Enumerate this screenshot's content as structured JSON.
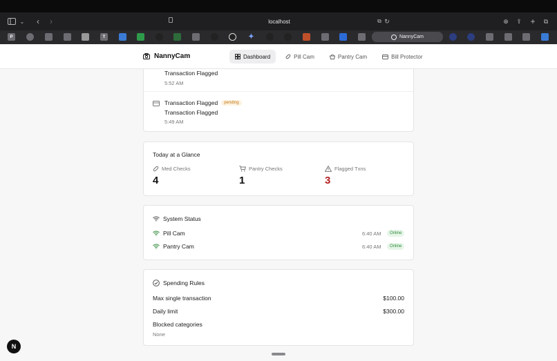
{
  "browser": {
    "url": "localhost",
    "active_tab_label": "NannyCam"
  },
  "app": {
    "brand": "NannyCam",
    "nav": [
      {
        "label": "Dashboard",
        "icon": "grid-icon"
      },
      {
        "label": "Pill Cam",
        "icon": "pill-icon"
      },
      {
        "label": "Pantry Cam",
        "icon": "basket-icon"
      },
      {
        "label": "Bill Protector",
        "icon": "card-icon"
      }
    ]
  },
  "transactions": [
    {
      "title": "",
      "description": "Transaction Flagged",
      "time": "5:52 AM"
    },
    {
      "title": "Transaction Flagged",
      "badge": "pending",
      "description": "Transaction Flagged",
      "time": "5:49 AM"
    }
  ],
  "glance": {
    "title": "Today at a Glance",
    "items": [
      {
        "label": "Med Checks",
        "value": "4",
        "icon": "pill-icon"
      },
      {
        "label": "Pantry Checks",
        "value": "1",
        "icon": "cart-icon"
      },
      {
        "label": "Flagged Txns",
        "value": "3",
        "icon": "warning-icon"
      }
    ]
  },
  "system": {
    "title": "System Status",
    "devices": [
      {
        "name": "Pill Cam",
        "time": "6:40 AM",
        "status": "Online"
      },
      {
        "name": "Pantry Cam",
        "time": "6:40 AM",
        "status": "Online"
      }
    ]
  },
  "rules": {
    "title": "Spending Rules",
    "max_label": "Max single transaction",
    "max_value": "$100.00",
    "daily_label": "Daily limit",
    "daily_value": "$300.00",
    "blocked_label": "Blocked categories",
    "blocked_value": "None"
  },
  "colors": {
    "flag_red": "#b32020",
    "online_green": "#2f8a3b",
    "pending_orange": "#c27a1a"
  }
}
